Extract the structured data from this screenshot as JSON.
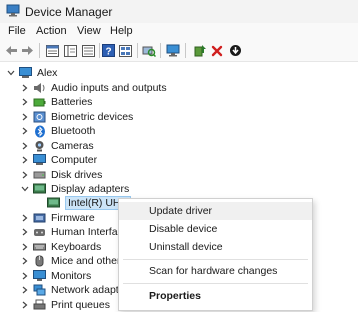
{
  "window": {
    "title": "Device Manager",
    "icon": "device-manager-icon"
  },
  "menu": [
    "File",
    "Action",
    "View",
    "Help"
  ],
  "toolbar": [
    "back-arrow-icon",
    "forward-arrow-icon",
    "properties-grid-icon",
    "show-hide-tree-icon",
    "help-icon",
    "view-icon",
    "scan-hardware-icon",
    "monitor-icon",
    "update-driver-icon",
    "uninstall-x-icon",
    "disable-down-icon"
  ],
  "tree": {
    "root": "Alex",
    "items": [
      {
        "label": "Audio inputs and outputs",
        "icon": "speaker-icon"
      },
      {
        "label": "Batteries",
        "icon": "battery-icon"
      },
      {
        "label": "Biometric devices",
        "icon": "fingerprint-icon"
      },
      {
        "label": "Bluetooth",
        "icon": "bluetooth-icon"
      },
      {
        "label": "Cameras",
        "icon": "camera-icon"
      },
      {
        "label": "Computer",
        "icon": "computer-icon"
      },
      {
        "label": "Disk drives",
        "icon": "disk-icon"
      },
      {
        "label": "Display adapters",
        "icon": "display-adapter-icon"
      },
      {
        "label": "Intel(R) UHD",
        "icon": "display-adapter-icon"
      },
      {
        "label": "Firmware",
        "icon": "firmware-icon"
      },
      {
        "label": "Human Interfac",
        "icon": "hid-icon"
      },
      {
        "label": "Keyboards",
        "icon": "keyboard-icon"
      },
      {
        "label": "Mice and other",
        "icon": "mouse-icon"
      },
      {
        "label": "Monitors",
        "icon": "monitor-icon"
      },
      {
        "label": "Network adapte",
        "icon": "network-icon"
      },
      {
        "label": "Print queues",
        "icon": "printer-icon"
      }
    ]
  },
  "context_menu": {
    "update": "Update driver",
    "disable": "Disable device",
    "uninstall": "Uninstall device",
    "scan": "Scan for hardware changes",
    "properties": "Properties"
  },
  "colors": {
    "selection": "#cce4f7",
    "accent": "#0078d4"
  }
}
